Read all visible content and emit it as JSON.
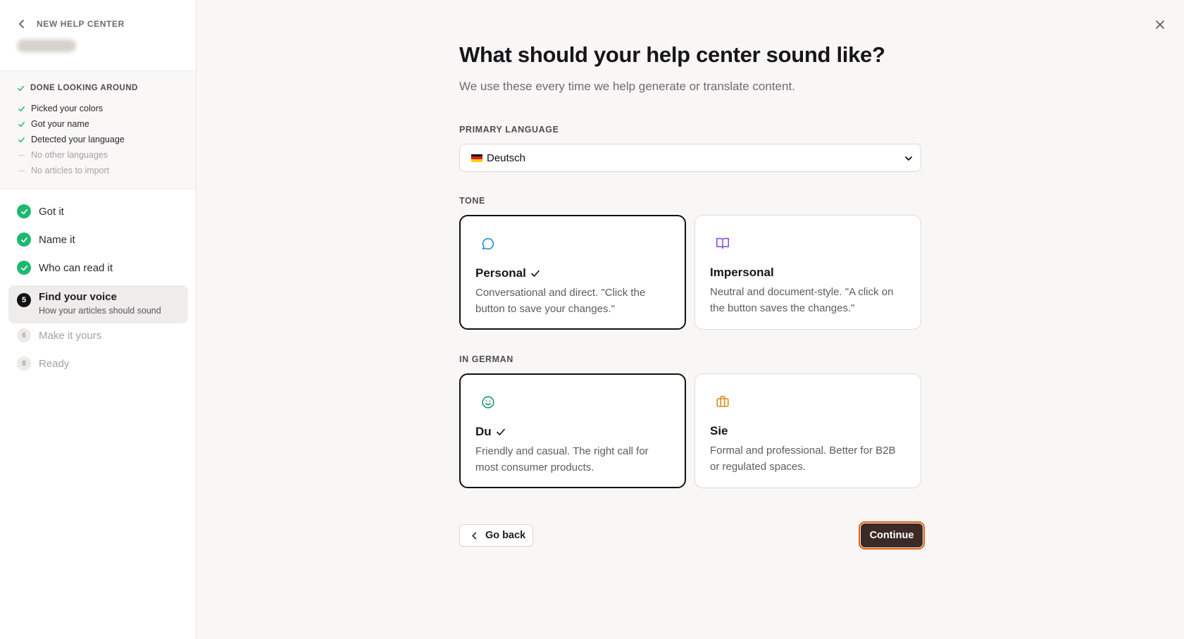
{
  "sidebar": {
    "back_label": "NEW HELP CENTER",
    "checklist": {
      "title": "DONE LOOKING AROUND",
      "items": [
        {
          "label": "Picked your colors",
          "status": "done"
        },
        {
          "label": "Got your name",
          "status": "done"
        },
        {
          "label": "Detected your language",
          "status": "done"
        },
        {
          "label": "No other languages",
          "status": "none"
        },
        {
          "label": "No articles to import",
          "status": "none"
        }
      ]
    },
    "steps": [
      {
        "number": "",
        "label": "Got it",
        "status": "done"
      },
      {
        "number": "",
        "label": "Name it",
        "status": "done"
      },
      {
        "number": "",
        "label": "Who can read it",
        "status": "done"
      },
      {
        "number": "5",
        "label": "Find your voice",
        "sublabel": "How your articles should sound",
        "status": "current"
      },
      {
        "number": "6",
        "label": "Make it yours",
        "status": "todo"
      },
      {
        "number": "8",
        "label": "Ready",
        "status": "todo"
      }
    ]
  },
  "main": {
    "title": "What should your help center sound like?",
    "subtitle": "We use these every time we help generate or translate content.",
    "language": {
      "label": "PRIMARY LANGUAGE",
      "selected": "Deutsch",
      "flag": "de-flag"
    },
    "tone": {
      "label": "TONE",
      "options": [
        {
          "title": "Personal",
          "desc": "Conversational and direct. \"Click the button to save your changes.\"",
          "icon": "chat-bubble-icon",
          "icon_color": "#1a8ad6",
          "selected": true
        },
        {
          "title": "Impersonal",
          "desc": "Neutral and document-style. \"A click on the button saves the changes.\"",
          "icon": "book-icon",
          "icon_color": "#8b4fd6",
          "selected": false
        }
      ]
    },
    "german": {
      "label": "IN GERMAN",
      "options": [
        {
          "title": "Du",
          "desc": "Friendly and casual. The right call for most consumer products.",
          "icon": "smiley-icon",
          "icon_color": "#17946a",
          "selected": true
        },
        {
          "title": "Sie",
          "desc": "Formal and professional. Better for B2B or regulated spaces.",
          "icon": "briefcase-icon",
          "icon_color": "#d98a1a",
          "selected": false
        }
      ]
    },
    "back_button": "Go back",
    "continue_button": "Continue"
  },
  "colors": {
    "accent_green": "#1fb872",
    "continue_bg": "#3c2a24",
    "focus_ring": "#e8590c"
  }
}
